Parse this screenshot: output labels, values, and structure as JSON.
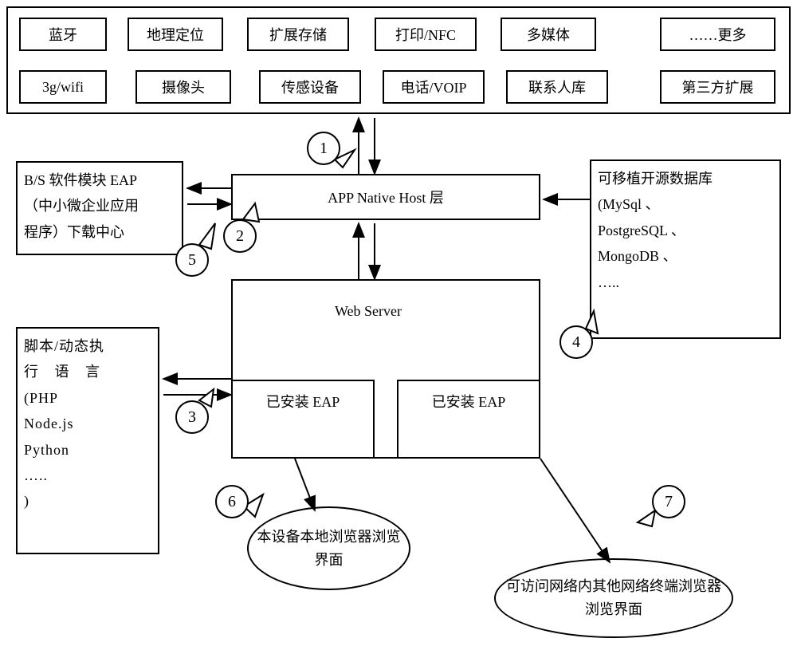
{
  "top_row1": [
    "蓝牙",
    "地理定位",
    "扩展存储",
    "打印/NFC",
    "多媒体",
    "……更多"
  ],
  "top_row2": [
    "3g/wifi",
    "摄像头",
    "传感设备",
    "电话/VOIP",
    "联系人库",
    "第三方扩展"
  ],
  "left_box1_lines": [
    "B/S 软件模块 EAP",
    "（中小微企业应用",
    "程序）下载中心"
  ],
  "left_box2_lines": [
    "脚本/动态执",
    "行 语 言",
    "(PHP",
    "Node.js",
    "Python",
    "…..",
    ")"
  ],
  "right_box_lines": [
    "可移植开源数据库",
    "(MySql          、",
    "PostgreSQL    、",
    "MongoDB 、",
    "….."
  ],
  "app_host": "APP Native Host 层",
  "web_server": "Web   Server",
  "installed_eap": "已安装 EAP",
  "ellipse6": "本设备本地浏览器浏览界面",
  "ellipse7": "可访问网络内其他网络终端浏览器浏览界面",
  "callouts": {
    "c1": "1",
    "c2": "2",
    "c3": "3",
    "c4": "4",
    "c5": "5",
    "c6": "6",
    "c7": "7"
  }
}
